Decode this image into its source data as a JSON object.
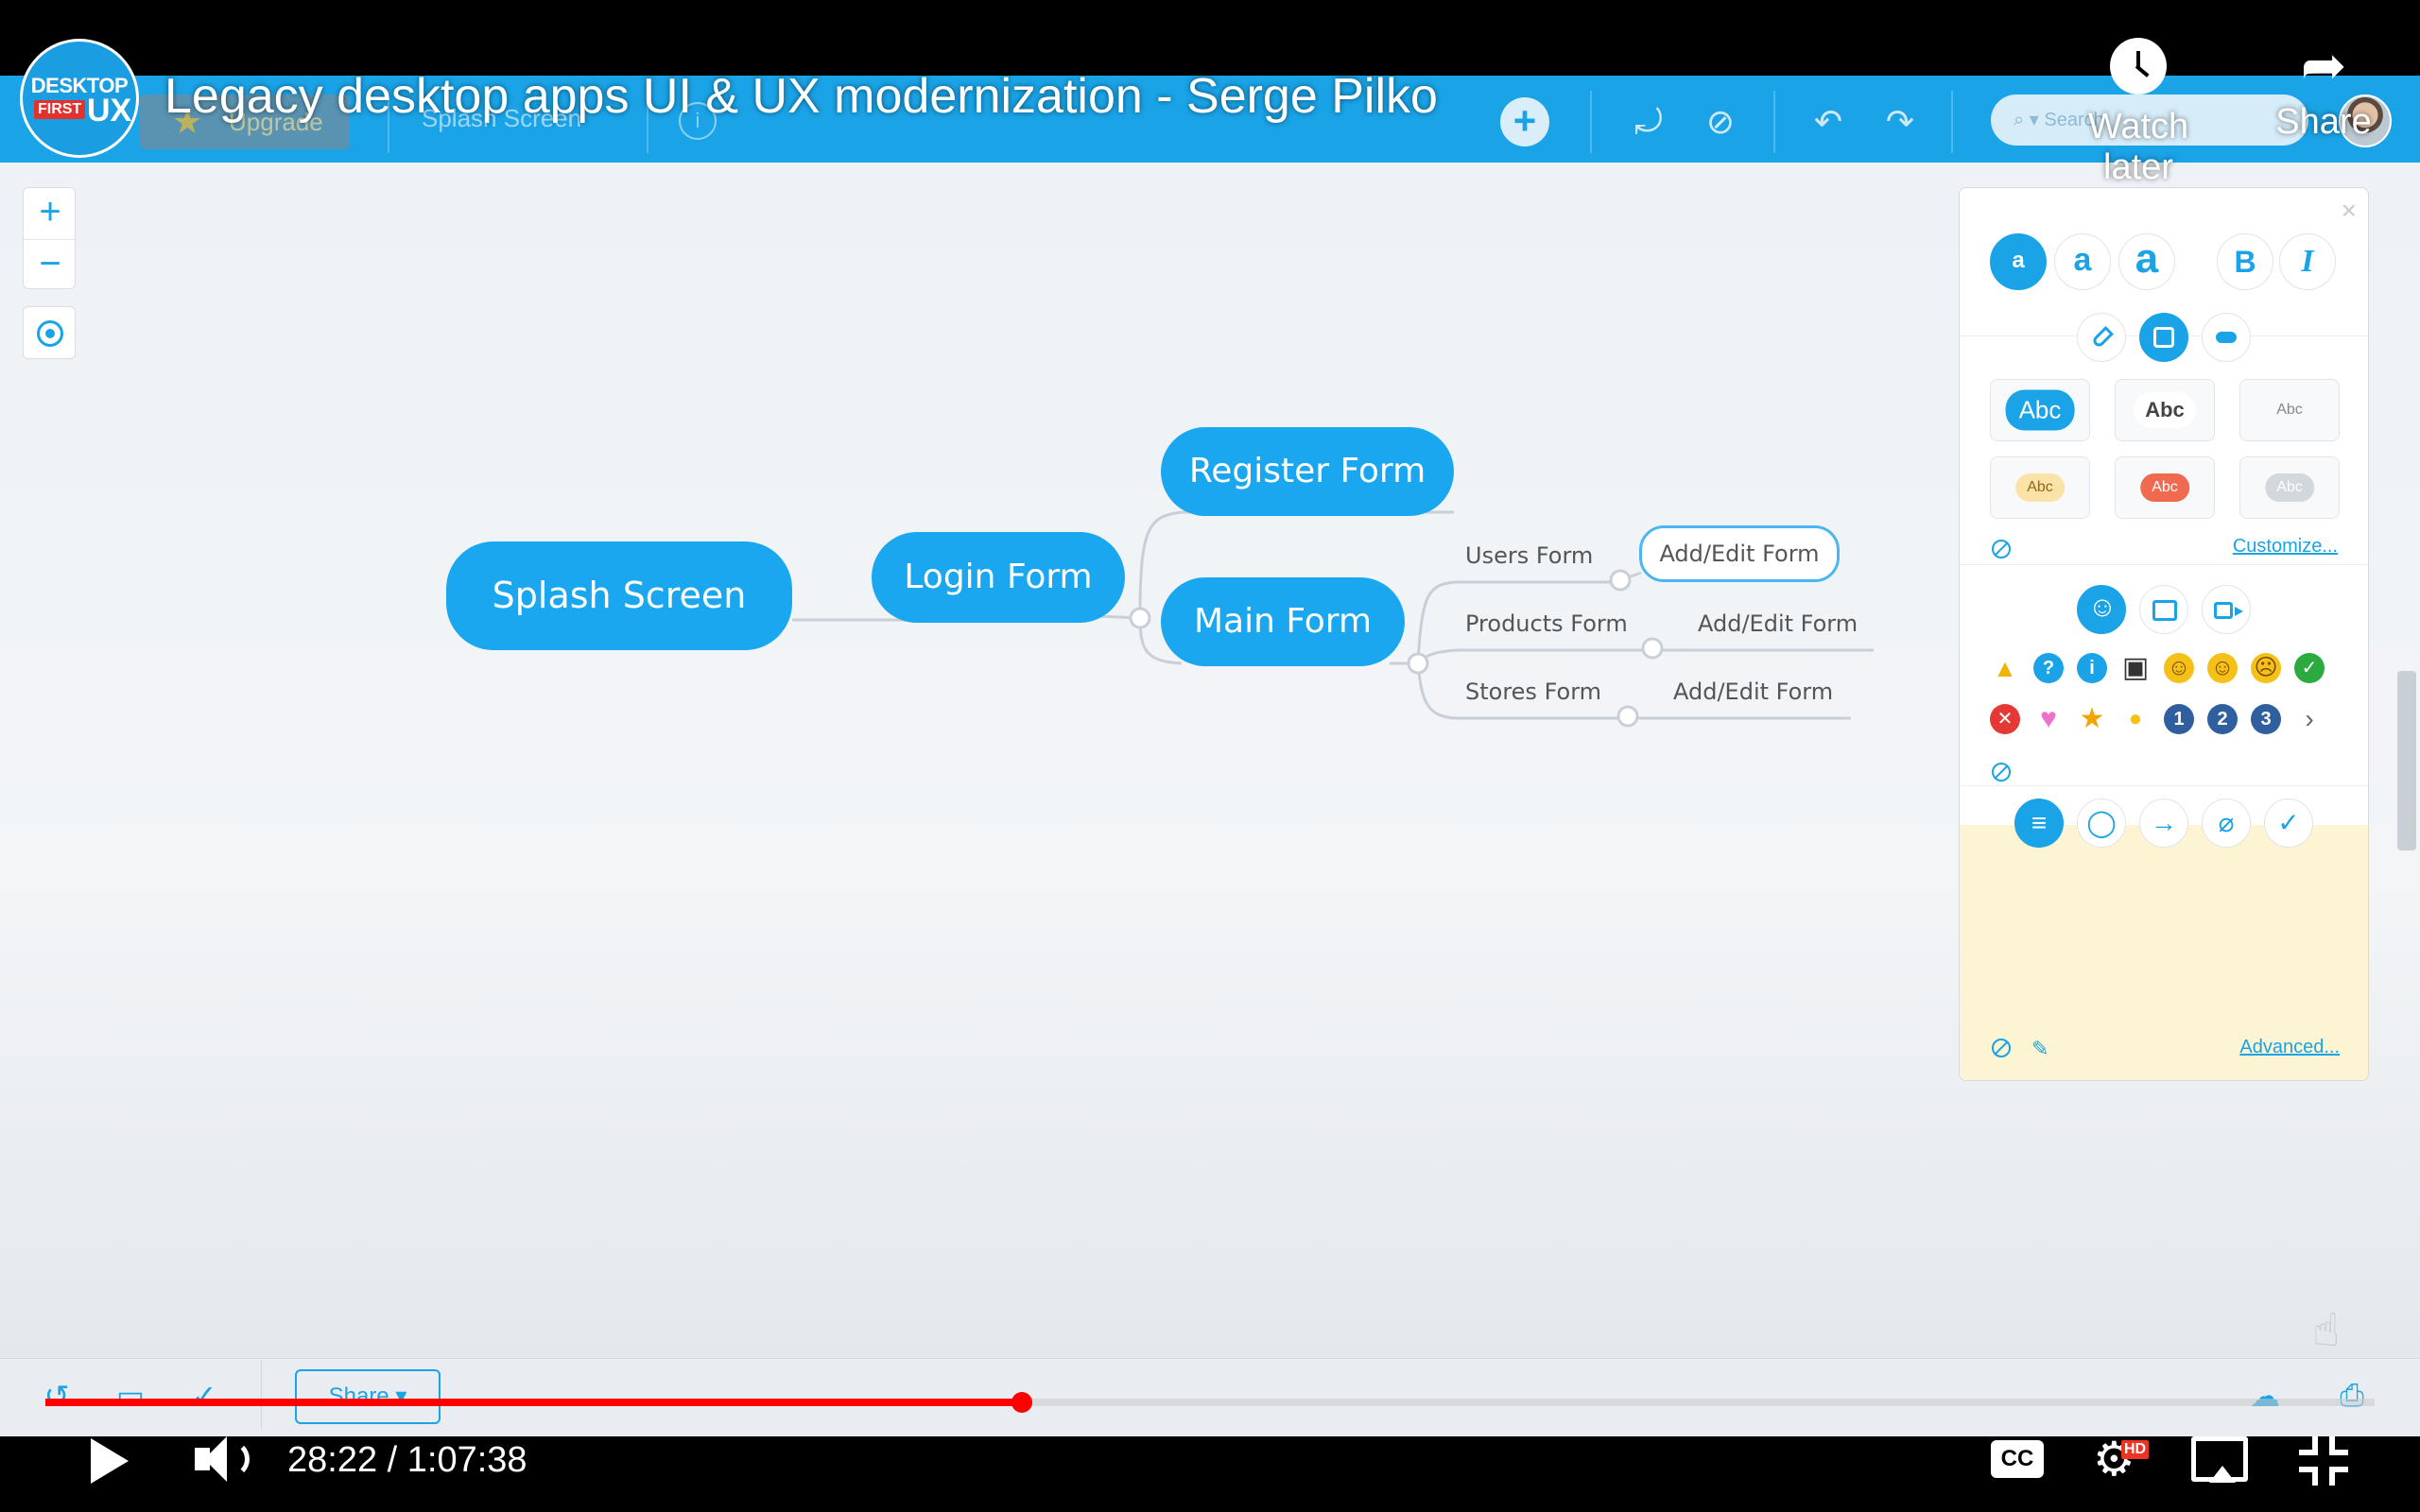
{
  "overlay": {
    "logo_line1": "DESKTOP",
    "logo_line2": "FIRST",
    "logo_line3": "UX",
    "video_title": "Legacy desktop apps UI & UX modernization - Serge Pilko",
    "watch_later_label": "Watch later",
    "share_label": "Share"
  },
  "app_toolbar": {
    "upgrade_label": "Upgrade",
    "breadcrumb": "Splash Screen",
    "info_label": "i",
    "add_label": "+",
    "search_placeholder": "Search"
  },
  "mindmap": {
    "root": "Splash Screen",
    "level1": "Login Form",
    "level2": [
      "Register Form",
      "Main Form"
    ],
    "level3": [
      "Users Form",
      "Products Form",
      "Stores Form"
    ],
    "level4": [
      "Add/Edit Form",
      "Add/Edit Form",
      "Add/Edit Form"
    ]
  },
  "zoom": {
    "in_label": "+",
    "out_label": "−"
  },
  "format_panel": {
    "close_label": "×",
    "font_sizes": [
      "a",
      "a",
      "a"
    ],
    "bold_label": "B",
    "italic_label": "I",
    "style_samples": [
      "Abc",
      "Abc",
      "Abc",
      "Abc",
      "Abc",
      "Abc"
    ],
    "customize_label": "Customize...",
    "advanced_label": "Advanced...",
    "icons_row1": [
      "warning-icon",
      "question-icon",
      "info-icon",
      "tablet-icon",
      "smile-icon",
      "neutral-icon",
      "frown-icon",
      "check-icon"
    ],
    "icons_row2": [
      "cross-icon",
      "heart-icon",
      "star-icon",
      "bulb-icon",
      "number-1-icon",
      "number-2-icon",
      "number-3-icon",
      "more-icon"
    ],
    "number_icons": [
      "1",
      "2",
      "3"
    ]
  },
  "bottom_toolbar": {
    "share_label": "Share ▾"
  },
  "player": {
    "current_time": "28:22",
    "duration": "1:07:38",
    "time_display": "28:22 / 1:07:38",
    "progress_fraction": 0.4194,
    "cc_label": "CC",
    "hd_label": "HD",
    "progress_color": "#ff0000"
  },
  "colors": {
    "accent": "#1aa3e6",
    "node": "#1ba7f0",
    "note": "#fdf4d3"
  }
}
